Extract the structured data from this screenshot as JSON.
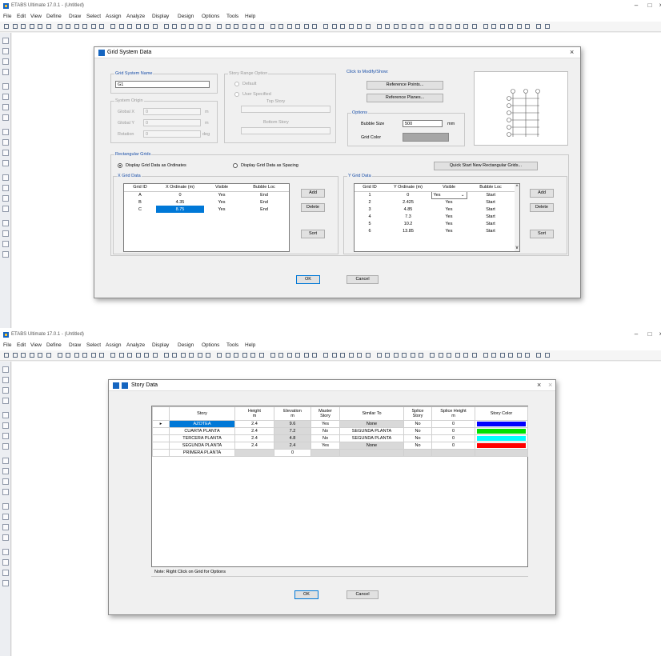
{
  "app": {
    "title": "ETABS Ultimate 17.0.1 - (Untitled)",
    "menu": [
      "File",
      "Edit",
      "View",
      "Define",
      "Draw",
      "Select",
      "Assign",
      "Analyze",
      "Display",
      "Design",
      "Options",
      "Tools",
      "Help"
    ]
  },
  "grid_dialog": {
    "title": "Grid System Data",
    "grid_system_name_label": "Grid System Name",
    "grid_system_name": "G1",
    "story_range_label": "Story Range Option",
    "story_range_default": "Default",
    "story_range_user": "User Specified",
    "top_story_label": "Top Story",
    "bottom_story_label": "Bottom Story",
    "system_origin_label": "System Origin",
    "global_x_label": "Global X",
    "global_x": "0",
    "global_x_unit": "m",
    "global_y_label": "Global Y",
    "global_y": "0",
    "global_y_unit": "m",
    "rotation_label": "Rotation",
    "rotation": "0",
    "rotation_unit": "deg",
    "click_modify_label": "Click to Modify/Show:",
    "reference_points_btn": "Reference Points...",
    "reference_planes_btn": "Reference Planes...",
    "options_label": "Options",
    "bubble_size_label": "Bubble Size",
    "bubble_size": "500",
    "bubble_size_unit": "mm",
    "grid_color_label": "Grid Color",
    "grid_color": "#a6a6a6",
    "rect_grids_label": "Rectangular Grids",
    "display_ordinates": "Display Grid Data as Ordinates",
    "display_spacing": "Display Grid Data as Spacing",
    "quick_start_btn": "Quick Start New Rectangular Grids...",
    "x_grid_label": "X Grid Data",
    "x_headers": [
      "Grid ID",
      "X Ordinate (m)",
      "Visible",
      "Bubble Loc"
    ],
    "x_rows": [
      {
        "id": "A",
        "ord": "0",
        "vis": "Yes",
        "loc": "End"
      },
      {
        "id": "B",
        "ord": "4.35",
        "vis": "Yes",
        "loc": "End"
      },
      {
        "id": "C",
        "ord": "8.75",
        "vis": "Yes",
        "loc": "End"
      }
    ],
    "y_grid_label": "Y Grid Data",
    "y_headers": [
      "Grid ID",
      "Y Ordinate (m)",
      "Visible",
      "Bubble Loc"
    ],
    "y_rows": [
      {
        "id": "1",
        "ord": "0",
        "vis": "Yes",
        "loc": "Start"
      },
      {
        "id": "2",
        "ord": "2.425",
        "vis": "Yes",
        "loc": "Start"
      },
      {
        "id": "3",
        "ord": "4.85",
        "vis": "Yes",
        "loc": "Start"
      },
      {
        "id": "4",
        "ord": "7.3",
        "vis": "Yes",
        "loc": "Start"
      },
      {
        "id": "5",
        "ord": "10.2",
        "vis": "Yes",
        "loc": "Start"
      },
      {
        "id": "6",
        "ord": "13.85",
        "vis": "Yes",
        "loc": "Start"
      }
    ],
    "add_btn": "Add",
    "delete_btn": "Delete",
    "sort_btn": "Sort",
    "ok_btn": "OK",
    "cancel_btn": "Cancel"
  },
  "story_dialog": {
    "title": "Story Data",
    "headers": [
      {
        "l1": "Story",
        "l2": ""
      },
      {
        "l1": "Height",
        "l2": "m"
      },
      {
        "l1": "Elevation",
        "l2": "m"
      },
      {
        "l1": "Master",
        "l2": "Story"
      },
      {
        "l1": "Similar To",
        "l2": ""
      },
      {
        "l1": "Splice",
        "l2": "Story"
      },
      {
        "l1": "Splice Height",
        "l2": "m"
      },
      {
        "l1": "Story Color",
        "l2": ""
      }
    ],
    "rows": [
      {
        "story": "AZOTEA",
        "height": "2.4",
        "elev": "9.6",
        "master": "Yes",
        "similar": "None",
        "splice": "No",
        "splice_h": "0",
        "color": "#0000ff"
      },
      {
        "story": "CUARTA PLANTA",
        "height": "2.4",
        "elev": "7.2",
        "master": "No",
        "similar": "SEGUNDA PLANTA",
        "splice": "No",
        "splice_h": "0",
        "color": "#00e000"
      },
      {
        "story": "TERCERA PLANTA",
        "height": "2.4",
        "elev": "4.8",
        "master": "No",
        "similar": "SEGUNDA PLANTA",
        "splice": "No",
        "splice_h": "0",
        "color": "#00ffff"
      },
      {
        "story": "SEGUNDA PLANTA",
        "height": "2.4",
        "elev": "2.4",
        "master": "Yes",
        "similar": "None",
        "splice": "No",
        "splice_h": "0",
        "color": "#ff0000"
      },
      {
        "story": "PRIMERA PLANTA",
        "height": "",
        "elev": "0",
        "master": "",
        "similar": "",
        "splice": "",
        "splice_h": "",
        "color": ""
      }
    ],
    "note": "Note: Right Click on Grid for Options",
    "ok_btn": "OK",
    "cancel_btn": "Cancel"
  }
}
